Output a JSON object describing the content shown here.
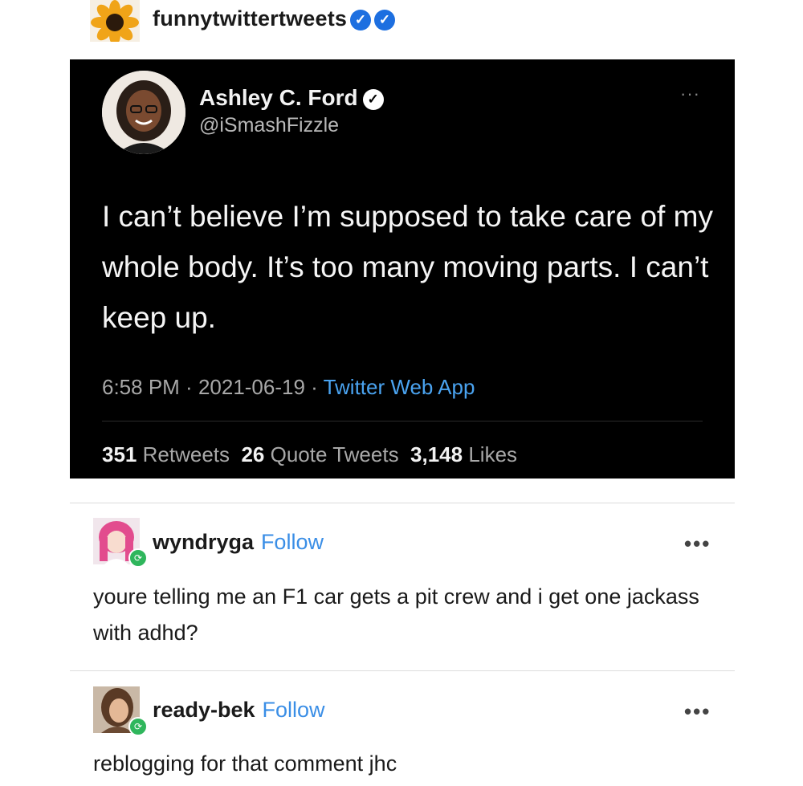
{
  "blog": {
    "name": "funnytwittertweets",
    "avatar_icon": "sunflower-icon",
    "verified_icon": "verified-badge-icon"
  },
  "tweet": {
    "author": "Ashley C. Ford",
    "handle": "@iSmashFizzle",
    "more": "···",
    "text": "I can’t believe I’m supposed to take care of my whole body. It’s too many moving parts. I can’t keep up.",
    "time": "6:58 PM",
    "date": "2021-06-19",
    "app": "Twitter Web App",
    "retweets_count": "351",
    "retweets_label": "Retweets",
    "quotes_count": "26",
    "quotes_label": "Quote Tweets",
    "likes_count": "3,148",
    "likes_label": "Likes"
  },
  "reblogs": [
    {
      "user": "wyndryga",
      "follow": "Follow",
      "more": "•••",
      "text": "youre telling me an F1 car gets a pit crew and i get one jackass with adhd?"
    },
    {
      "user": "ready-bek",
      "follow": "Follow",
      "more": "•••",
      "text": "reblogging for that comment jhc"
    }
  ]
}
